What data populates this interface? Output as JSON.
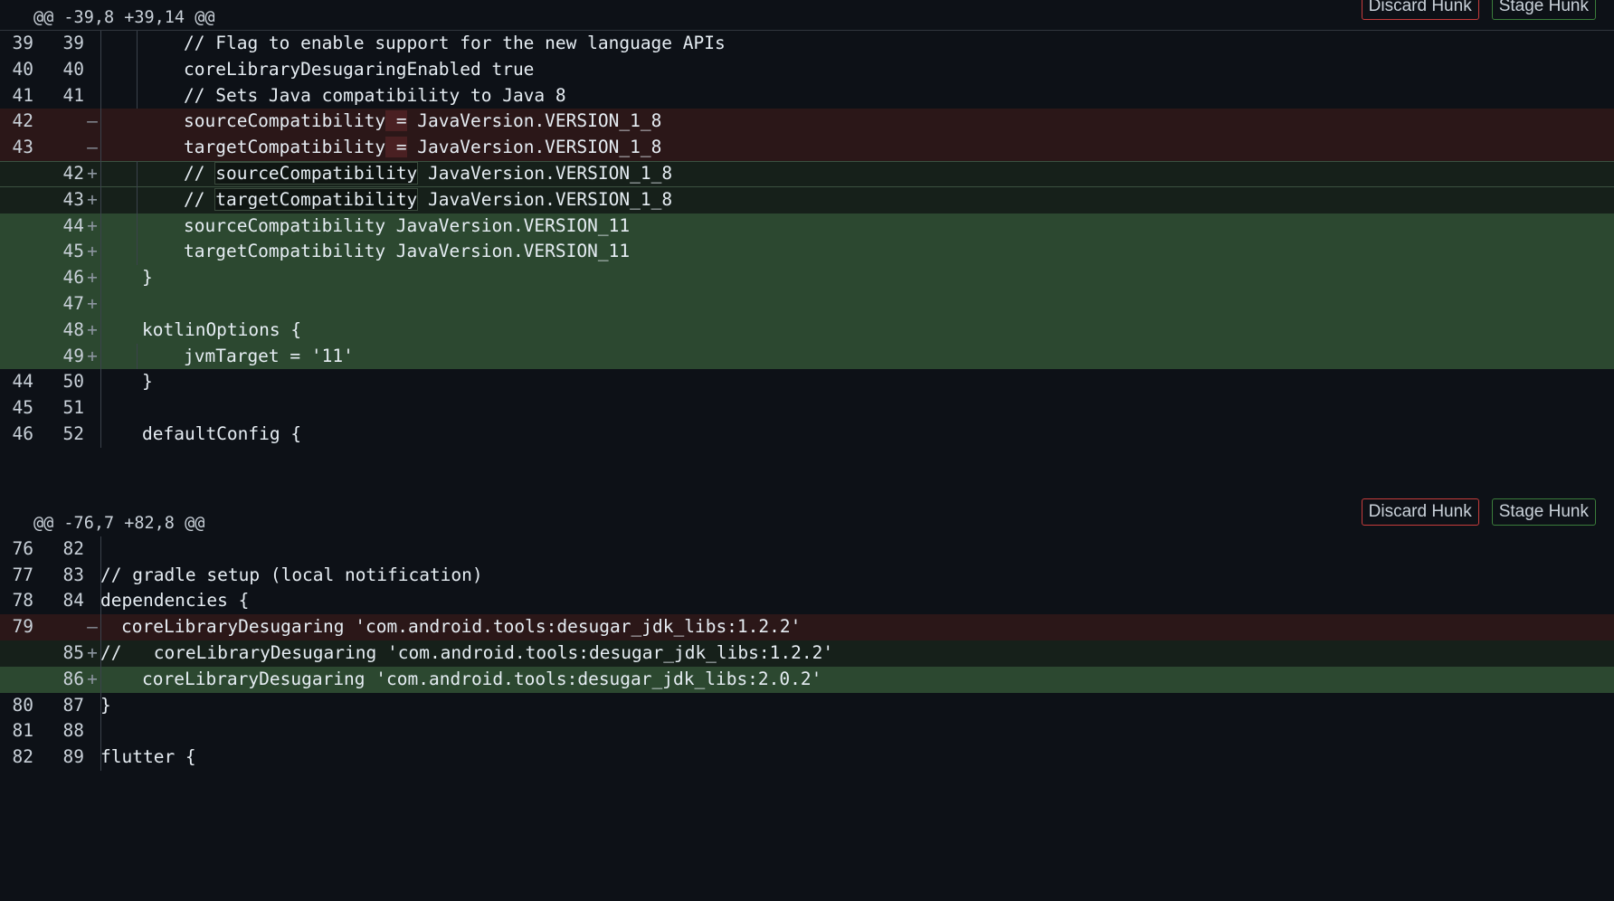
{
  "buttons": {
    "discard": "Discard Hunk",
    "stage": "Stage Hunk"
  },
  "hunks": [
    {
      "header": "@@ -39,8 +39,14 @@",
      "lines": [
        {
          "old": "39",
          "new": "39",
          "marker": "",
          "type": "ctx",
          "text": "// Flag to enable support for the new language APIs"
        },
        {
          "old": "40",
          "new": "40",
          "marker": "",
          "type": "ctx",
          "text": "coreLibraryDesugaringEnabled true"
        },
        {
          "old": "41",
          "new": "41",
          "marker": "",
          "type": "ctx",
          "text": "// Sets Java compatibility to Java 8"
        },
        {
          "old": "42",
          "new": "",
          "marker": "—",
          "type": "del",
          "a": "sourceCompatibility",
          "b": "=",
          "c": " JavaVersion.VERSION_1_8"
        },
        {
          "old": "43",
          "new": "",
          "marker": "—",
          "type": "del",
          "a": "targetCompatibility",
          "b": "=",
          "c": " JavaVersion.VERSION_1_8"
        },
        {
          "old": "",
          "new": "42",
          "marker": "+",
          "type": "mod",
          "a": "// ",
          "b": "sourceCompatibility",
          "c": " JavaVersion.VERSION_1_8"
        },
        {
          "old": "",
          "new": "43",
          "marker": "+",
          "type": "mod",
          "a": "// ",
          "b": "targetCompatibility",
          "c": " JavaVersion.VERSION_1_8"
        },
        {
          "old": "",
          "new": "44",
          "marker": "+",
          "type": "add",
          "text": "sourceCompatibility JavaVersion.VERSION_11"
        },
        {
          "old": "",
          "new": "45",
          "marker": "+",
          "type": "add",
          "text": "targetCompatibility JavaVersion.VERSION_11"
        },
        {
          "old": "",
          "new": "46",
          "marker": "+",
          "type": "add",
          "text": "}"
        },
        {
          "old": "",
          "new": "47",
          "marker": "+",
          "type": "add",
          "text": ""
        },
        {
          "old": "",
          "new": "48",
          "marker": "+",
          "type": "add",
          "text": "kotlinOptions {"
        },
        {
          "old": "",
          "new": "49",
          "marker": "+",
          "type": "add",
          "text": "jvmTarget = '11'"
        },
        {
          "old": "44",
          "new": "50",
          "marker": "",
          "type": "ctx",
          "text": "}"
        },
        {
          "old": "45",
          "new": "51",
          "marker": "",
          "type": "ctx",
          "text": ""
        },
        {
          "old": "46",
          "new": "52",
          "marker": "",
          "type": "ctx",
          "text": "defaultConfig {"
        }
      ]
    },
    {
      "header": "@@ -76,7 +82,8 @@",
      "lines": [
        {
          "old": "76",
          "new": "82",
          "marker": "",
          "type": "ctx",
          "text": ""
        },
        {
          "old": "77",
          "new": "83",
          "marker": "",
          "type": "ctx",
          "text": "// gradle setup (local notification)"
        },
        {
          "old": "78",
          "new": "84",
          "marker": "",
          "type": "ctx",
          "text": "dependencies {"
        },
        {
          "old": "79",
          "new": "",
          "marker": "—",
          "type": "del",
          "text": "coreLibraryDesugaring 'com.android.tools:desugar_jdk_libs:1.2.2'"
        },
        {
          "old": "",
          "new": "85",
          "marker": "+",
          "type": "mod",
          "text": "//   coreLibraryDesugaring 'com.android.tools:desugar_jdk_libs:1.2.2'"
        },
        {
          "old": "",
          "new": "86",
          "marker": "+",
          "type": "add",
          "text": "coreLibraryDesugaring 'com.android.tools:desugar_jdk_libs:2.0.2'"
        },
        {
          "old": "80",
          "new": "87",
          "marker": "",
          "type": "ctx",
          "text": "}"
        },
        {
          "old": "81",
          "new": "88",
          "marker": "",
          "type": "ctx",
          "text": ""
        },
        {
          "old": "82",
          "new": "89",
          "marker": "",
          "type": "ctx",
          "text": "flutter {"
        }
      ]
    }
  ]
}
